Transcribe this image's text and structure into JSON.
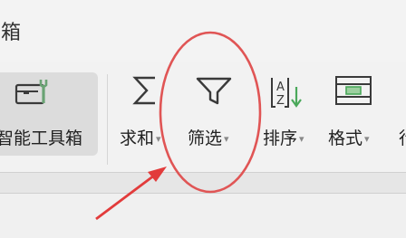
{
  "window": {
    "title": "具箱"
  },
  "ribbon": {
    "smart_toolbox": {
      "label": "智能工具箱",
      "icon": "toolbox-wrench-icon"
    },
    "sum": {
      "label": "求和",
      "icon": "sigma-icon"
    },
    "filter": {
      "label": "筛选",
      "icon": "funnel-icon"
    },
    "sort": {
      "label": "排序",
      "icon": "sort-az-icon"
    },
    "format": {
      "label": "格式",
      "icon": "table-format-icon"
    },
    "more": {
      "label": "行"
    }
  },
  "annotations": {
    "circle_color": "#e05555",
    "arrow_color": "#e23b3b"
  },
  "colors": {
    "icon_stroke": "#3a3a3a",
    "toolbox_accent": "#6aa374"
  }
}
